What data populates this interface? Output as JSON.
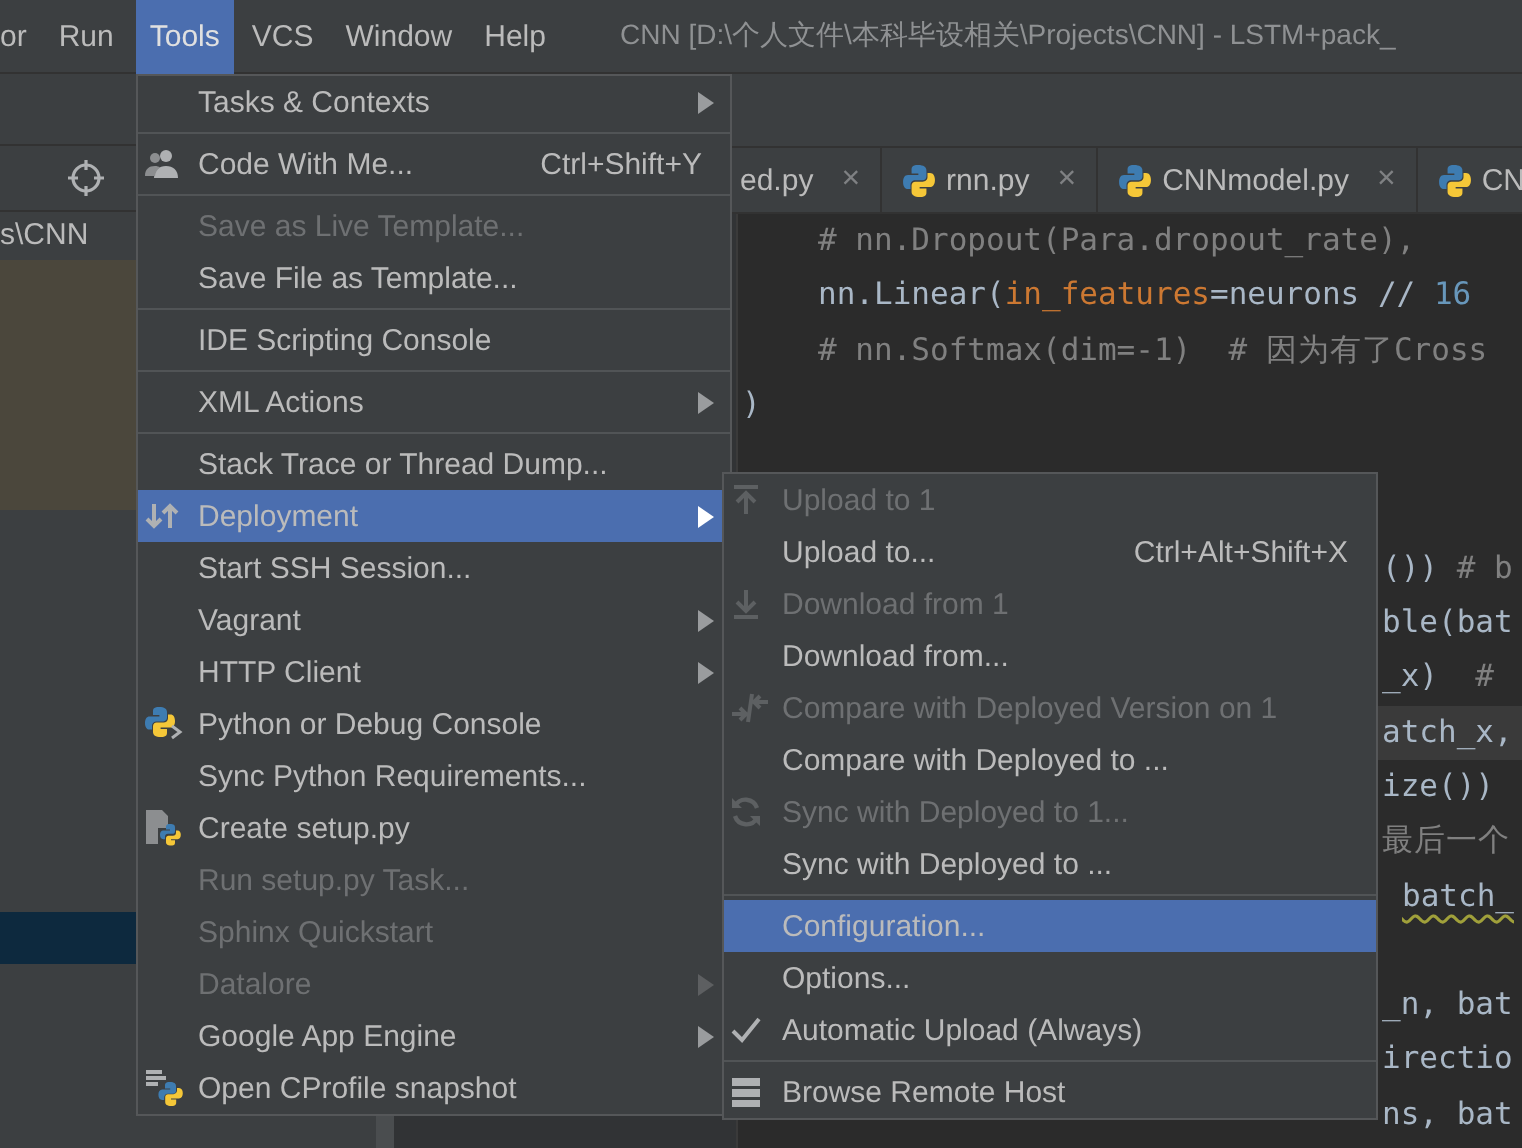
{
  "menubar": {
    "items": [
      {
        "label": "or",
        "selected": false
      },
      {
        "label": "Run",
        "selected": false
      },
      {
        "label": "Tools",
        "selected": true
      },
      {
        "label": "VCS",
        "selected": false
      },
      {
        "label": "Window",
        "selected": false
      },
      {
        "label": "Help",
        "selected": false
      }
    ],
    "title": "CNN [D:\\个人文件\\本科毕设相关\\Projects\\CNN] - LSTM+pack_"
  },
  "project_panel": {
    "path_fragment": "s\\CNN"
  },
  "tabs": [
    {
      "label": "ed.py",
      "close": "×"
    },
    {
      "label": "rnn.py",
      "close": "×"
    },
    {
      "label": "CNNmodel.py",
      "close": "×"
    },
    {
      "label": "CN"
    }
  ],
  "code_lines": [
    {
      "kind": "indented",
      "current": false,
      "warning": false,
      "segments": [
        {
          "text": "# nn.Dropout(Para.dropout_rate),",
          "kind": "comment"
        }
      ]
    },
    {
      "kind": "indented",
      "current": false,
      "warning": false,
      "segments": [
        {
          "text": "nn.Linear(",
          "kind": "plain"
        },
        {
          "text": "in_features",
          "kind": "param"
        },
        {
          "text": "=neurons // ",
          "kind": "plain"
        },
        {
          "text": "16",
          "kind": "number"
        }
      ]
    },
    {
      "kind": "indented",
      "current": false,
      "warning": false,
      "segments": [
        {
          "text": "# nn.Softmax(dim=-1)  # 因为有了Cross",
          "kind": "comment"
        }
      ]
    },
    {
      "kind": "outer",
      "current": false,
      "warning": false,
      "segments": [
        {
          "text": ")",
          "kind": "plain"
        }
      ]
    },
    {
      "kind": "blank"
    },
    {
      "kind": "blank"
    },
    {
      "kind": "tail",
      "current": false,
      "warning": false,
      "segments": [
        {
          "text": "()) ",
          "kind": "plain"
        },
        {
          "text": "# b",
          "kind": "comment"
        }
      ]
    },
    {
      "kind": "tail",
      "current": false,
      "warning": false,
      "segments": [
        {
          "text": "ble(bat",
          "kind": "plain"
        }
      ]
    },
    {
      "kind": "tail",
      "current": false,
      "warning": false,
      "segments": [
        {
          "text": "_x)  ",
          "kind": "plain"
        },
        {
          "text": "#",
          "kind": "comment"
        }
      ]
    },
    {
      "kind": "tail",
      "current": true,
      "warning": false,
      "segments": [
        {
          "text": "atch_x,",
          "kind": "plain"
        }
      ]
    },
    {
      "kind": "tail",
      "current": false,
      "warning": false,
      "segments": [
        {
          "text": "ize())",
          "kind": "plain"
        }
      ]
    },
    {
      "kind": "tail",
      "current": false,
      "warning": false,
      "segments": [
        {
          "text": "最后一个",
          "kind": "comment"
        }
      ]
    },
    {
      "kind": "tail",
      "current": false,
      "warning": true,
      "segments": [
        {
          "text": "batch_",
          "kind": "plain"
        }
      ]
    },
    {
      "kind": "blank"
    },
    {
      "kind": "tail",
      "current": false,
      "warning": false,
      "segments": [
        {
          "text": "_n, bat",
          "kind": "plain"
        }
      ]
    },
    {
      "kind": "tail",
      "current": false,
      "warning": false,
      "segments": [
        {
          "text": "irectio",
          "kind": "plain"
        }
      ]
    },
    {
      "kind": "tail",
      "current": false,
      "warning": false,
      "segments": [
        {
          "text": "ns, bat",
          "kind": "plain"
        }
      ]
    }
  ],
  "tools_menu": {
    "items": [
      {
        "kind": "item",
        "label": "Tasks & Contexts",
        "selected": false,
        "disabled": false,
        "submenu": true
      },
      {
        "kind": "separator"
      },
      {
        "kind": "item",
        "label": "Code With Me...",
        "shortcut": "Ctrl+Shift+Y",
        "selected": false,
        "disabled": false,
        "submenu": false
      },
      {
        "kind": "separator"
      },
      {
        "kind": "item",
        "label": "Save as Live Template...",
        "selected": false,
        "disabled": true,
        "submenu": false
      },
      {
        "kind": "item",
        "label": "Save File as Template...",
        "selected": false,
        "disabled": false,
        "submenu": false
      },
      {
        "kind": "separator"
      },
      {
        "kind": "item",
        "label": "IDE Scripting Console",
        "selected": false,
        "disabled": false,
        "submenu": false
      },
      {
        "kind": "separator"
      },
      {
        "kind": "item",
        "label": "XML Actions",
        "selected": false,
        "disabled": false,
        "submenu": true
      },
      {
        "kind": "separator"
      },
      {
        "kind": "item",
        "label": "Stack Trace or Thread Dump...",
        "selected": false,
        "disabled": false,
        "submenu": false
      },
      {
        "kind": "item",
        "label": "Deployment",
        "selected": true,
        "disabled": false,
        "submenu": true
      },
      {
        "kind": "item",
        "label": "Start SSH Session...",
        "selected": false,
        "disabled": false,
        "submenu": false
      },
      {
        "kind": "item",
        "label": "Vagrant",
        "selected": false,
        "disabled": false,
        "submenu": true
      },
      {
        "kind": "item",
        "label": "HTTP Client",
        "selected": false,
        "disabled": false,
        "submenu": true
      },
      {
        "kind": "item",
        "label": "Python or Debug Console",
        "selected": false,
        "disabled": false,
        "submenu": false
      },
      {
        "kind": "item",
        "label": "Sync Python Requirements...",
        "selected": false,
        "disabled": false,
        "submenu": false
      },
      {
        "kind": "item",
        "label": "Create setup.py",
        "selected": false,
        "disabled": false,
        "submenu": false
      },
      {
        "kind": "item",
        "label": "Run setup.py Task...",
        "selected": false,
        "disabled": true,
        "submenu": false
      },
      {
        "kind": "item",
        "label": "Sphinx Quickstart",
        "selected": false,
        "disabled": true,
        "submenu": false
      },
      {
        "kind": "item",
        "label": "Datalore",
        "selected": false,
        "disabled": true,
        "submenu": true
      },
      {
        "kind": "item",
        "label": "Google App Engine",
        "selected": false,
        "disabled": false,
        "submenu": true
      },
      {
        "kind": "item",
        "label": "Open CProfile snapshot",
        "selected": false,
        "disabled": false,
        "submenu": false
      }
    ]
  },
  "deployment_submenu": {
    "items": [
      {
        "kind": "item",
        "label": "Upload to 1",
        "selected": false,
        "disabled": true,
        "checked": false
      },
      {
        "kind": "item",
        "label": "Upload to...",
        "shortcut": "Ctrl+Alt+Shift+X",
        "selected": false,
        "disabled": false,
        "checked": false
      },
      {
        "kind": "item",
        "label": "Download from 1",
        "selected": false,
        "disabled": true,
        "checked": false
      },
      {
        "kind": "item",
        "label": "Download from...",
        "selected": false,
        "disabled": false,
        "checked": false
      },
      {
        "kind": "item",
        "label": "Compare with Deployed Version on 1",
        "selected": false,
        "disabled": true,
        "checked": false
      },
      {
        "kind": "item",
        "label": "Compare with Deployed to ...",
        "selected": false,
        "disabled": false,
        "checked": false
      },
      {
        "kind": "item",
        "label": "Sync with Deployed to 1...",
        "selected": false,
        "disabled": true,
        "checked": false
      },
      {
        "kind": "item",
        "label": "Sync with Deployed to ...",
        "selected": false,
        "disabled": false,
        "checked": false
      },
      {
        "kind": "separator"
      },
      {
        "kind": "item",
        "label": "Configuration...",
        "selected": true,
        "disabled": false,
        "checked": false
      },
      {
        "kind": "item",
        "label": "Options...",
        "selected": false,
        "disabled": false,
        "checked": false
      },
      {
        "kind": "item",
        "label": "Automatic Upload (Always)",
        "selected": false,
        "disabled": false,
        "checked": true
      },
      {
        "kind": "separator"
      },
      {
        "kind": "item",
        "label": "Browse Remote Host",
        "selected": false,
        "disabled": false,
        "checked": false
      }
    ]
  }
}
